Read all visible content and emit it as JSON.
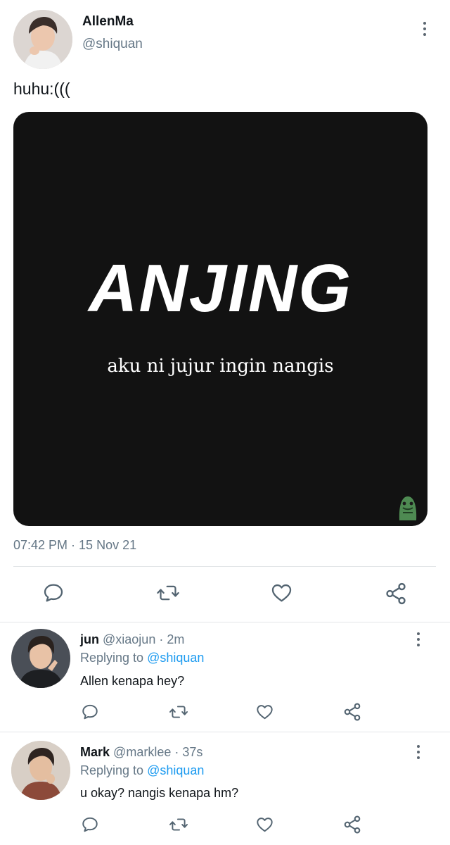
{
  "tweet": {
    "display_name": "AllenMa",
    "handle": "@shiquan",
    "text": "huhu:(((",
    "image": {
      "headline": "ANJING",
      "subtitle": "aku ni jujur ingin nangis",
      "background": "#121212"
    },
    "timestamp": "07:42 PM · 15 Nov 21"
  },
  "replies": [
    {
      "display_name": "jun",
      "handle": "@xiaojun",
      "time": "· 2m",
      "replying_prefix": "Replying to",
      "replying_to": "@shiquan",
      "text": "Allen kenapa hey?"
    },
    {
      "display_name": "Mark",
      "handle": "@marklee",
      "time": "· 37s",
      "replying_prefix": "Replying to",
      "replying_to": "@shiquan",
      "text": "u okay? nangis kenapa hm?"
    }
  ],
  "icons": {
    "reply": "comment-icon",
    "retweet": "retweet-icon",
    "like": "heart-icon",
    "share": "share-icon",
    "more": "more-vertical-icon"
  },
  "colors": {
    "link": "#1d9bf0",
    "icon": "#536471",
    "muted": "#657786"
  }
}
